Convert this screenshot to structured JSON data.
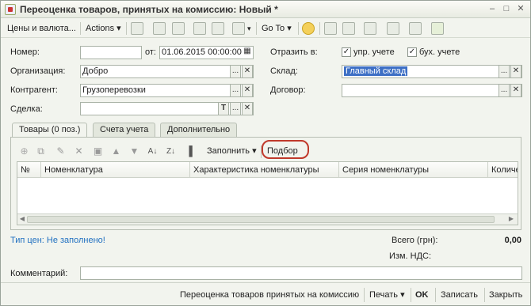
{
  "window": {
    "title": "Переоценка товаров, принятых на комиссию: Новый *"
  },
  "toolbar": {
    "prices_currency": "Цены и валюта...",
    "actions": "Actions",
    "goto": "Go To"
  },
  "form": {
    "number_label": "Номер:",
    "number_value": "",
    "date_label": "от:",
    "date_value": "01.06.2015 00:00:00",
    "reflect_label": "Отразить в:",
    "mgmt_label": "упр. учете",
    "acct_label": "бух. учете",
    "org_label": "Организация:",
    "org_value": "Добро",
    "warehouse_label": "Склад:",
    "warehouse_value": "Главный склад",
    "counterparty_label": "Контрагент:",
    "counterparty_value": "Грузоперевозки",
    "contract_label": "Договор:",
    "contract_value": "",
    "deal_label": "Сделка:",
    "deal_value": ""
  },
  "tabs": [
    {
      "label": "Товары (0 поз.)"
    },
    {
      "label": "Счета учета"
    },
    {
      "label": "Дополнительно"
    }
  ],
  "table": {
    "fill_label": "Заполнить",
    "pick_label": "Подбор",
    "columns": [
      "№",
      "Номенклатура",
      "Характеристика номенклатуры",
      "Серия номенклатуры",
      "Количество"
    ]
  },
  "footer": {
    "price_type": "Тип цен: Не заполнено!",
    "total_label": "Всего (грн):",
    "total_value": "0,00",
    "vat_label": "Изм. НДС:",
    "comment_label": "Комментарий:",
    "comment_value": ""
  },
  "bottom": {
    "print_form": "Переоценка товаров принятых на комиссию",
    "print": "Печать",
    "ok": "OK",
    "save": "Записать",
    "close": "Закрыть"
  }
}
